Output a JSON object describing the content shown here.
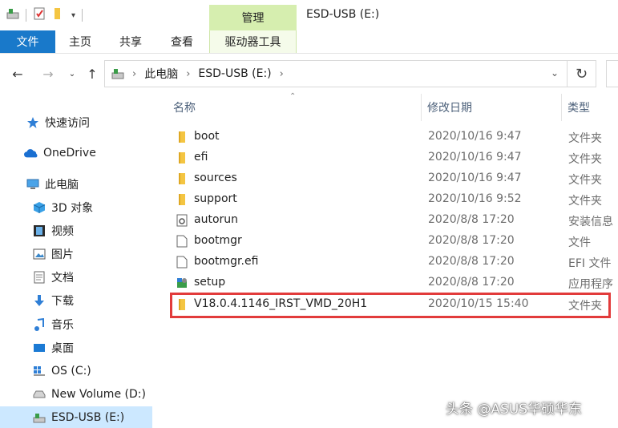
{
  "window": {
    "title": "ESD-USB (E:)"
  },
  "ribbon": {
    "context_group": "管理",
    "tabs": [
      {
        "label": "文件"
      },
      {
        "label": "主页"
      },
      {
        "label": "共享"
      },
      {
        "label": "查看"
      },
      {
        "label": "驱动器工具"
      }
    ]
  },
  "address": {
    "crumbs": [
      "此电脑",
      "ESD-USB (E:)"
    ]
  },
  "nav_pane": {
    "items": [
      {
        "label": "快速访问",
        "icon": "star-icon"
      },
      {
        "label": "OneDrive",
        "icon": "cloud-icon"
      },
      {
        "label": "此电脑",
        "icon": "computer-icon"
      },
      {
        "label": "3D 对象",
        "icon": "cube-icon"
      },
      {
        "label": "视频",
        "icon": "film-icon"
      },
      {
        "label": "图片",
        "icon": "picture-icon"
      },
      {
        "label": "文档",
        "icon": "document-icon"
      },
      {
        "label": "下载",
        "icon": "download-icon"
      },
      {
        "label": "音乐",
        "icon": "music-icon"
      },
      {
        "label": "桌面",
        "icon": "desktop-icon"
      },
      {
        "label": "OS (C:)",
        "icon": "windows-drive-icon"
      },
      {
        "label": "New Volume (D:)",
        "icon": "drive-icon"
      },
      {
        "label": "ESD-USB (E:)",
        "icon": "usb-drive-icon",
        "selected": true
      }
    ]
  },
  "file_list": {
    "columns": {
      "name": "名称",
      "modified": "修改日期",
      "type": "类型"
    },
    "rows": [
      {
        "name": "boot",
        "modified": "2020/10/16 9:47",
        "type": "文件夹",
        "icon": "folder-icon"
      },
      {
        "name": "efi",
        "modified": "2020/10/16 9:47",
        "type": "文件夹",
        "icon": "folder-icon"
      },
      {
        "name": "sources",
        "modified": "2020/10/16 9:47",
        "type": "文件夹",
        "icon": "folder-icon"
      },
      {
        "name": "support",
        "modified": "2020/10/16 9:52",
        "type": "文件夹",
        "icon": "folder-icon"
      },
      {
        "name": "autorun",
        "modified": "2020/8/8 17:20",
        "type": "安装信息",
        "icon": "setup-info-icon"
      },
      {
        "name": "bootmgr",
        "modified": "2020/8/8 17:20",
        "type": "文件",
        "icon": "file-icon"
      },
      {
        "name": "bootmgr.efi",
        "modified": "2020/8/8 17:20",
        "type": "EFI 文件",
        "icon": "file-icon"
      },
      {
        "name": "setup",
        "modified": "2020/8/8 17:20",
        "type": "应用程序",
        "icon": "setup-app-icon"
      },
      {
        "name": "V18.0.4.1146_IRST_VMD_20H1",
        "modified": "2020/10/15 15:40",
        "type": "文件夹",
        "icon": "folder-icon",
        "highlighted": true
      }
    ]
  },
  "watermark": "头条 @ASUS华硕华东",
  "colors": {
    "file_tab": "#1979ca",
    "context_tab": "#d6eeaf",
    "highlight": "#e23b3b",
    "folder": "#f4c542",
    "selected": "#cce8ff"
  }
}
